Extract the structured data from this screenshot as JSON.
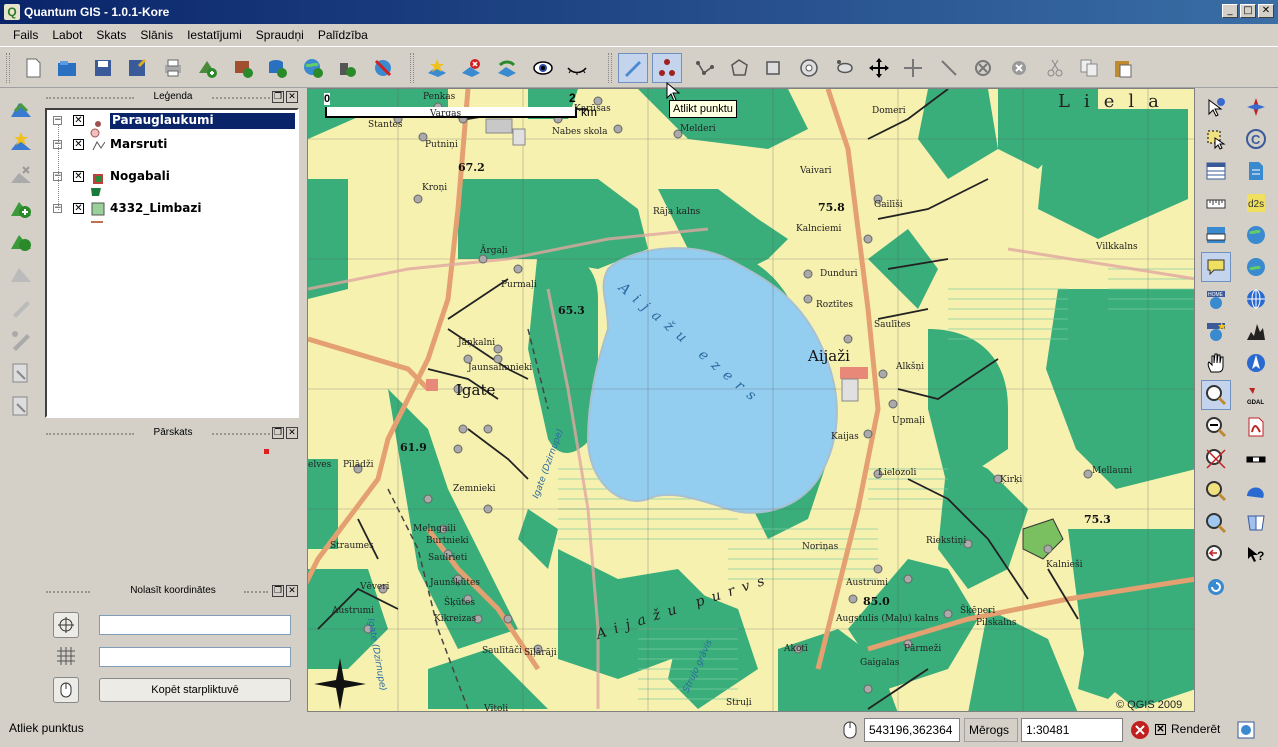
{
  "window": {
    "title": "Quantum GIS - 1.0.1-Kore",
    "app_icon_letter": "Q"
  },
  "menu": [
    "Fails",
    "Labot",
    "Skats",
    "Slānis",
    "Iestatījumi",
    "Spraudņi",
    "Palīdzība"
  ],
  "docks": {
    "legend": {
      "title": "Leģenda"
    },
    "overview": {
      "title": "Pārskats"
    },
    "coords": {
      "title": "Nolasīt koordinātes",
      "copy_button": "Kopēt starpliktuvē"
    }
  },
  "layers": [
    {
      "name": "Parauglaukumi",
      "checked": true,
      "selected": true
    },
    {
      "name": "Marsruti",
      "checked": true,
      "selected": false
    },
    {
      "name": "Nogabali",
      "checked": true,
      "selected": false
    },
    {
      "name": "4332_Limbazi",
      "checked": true,
      "selected": false
    }
  ],
  "map": {
    "tooltip": "Atlikt punktu",
    "scale_bar": {
      "start": "0",
      "end": "2",
      "unit": "km"
    },
    "copyright": "© QGIS 2009",
    "lake_name": "Aijažu ezers",
    "bog_name": "Aijažu purvs",
    "region_name": "Liela",
    "places": [
      "Penkas",
      "Vargas",
      "Karūsas",
      "Stantes",
      "Nabes skola",
      "Melderi",
      "Putniņi",
      "Kroņi",
      "Rāja kalns",
      "Ārgaļi",
      "Purmaļi",
      "Jāņkalni",
      "Jaunsaimnieki",
      "Igate",
      "Pīlādži",
      "Zemnieki",
      "Meļngaiļi",
      "Burtnieki",
      "Saulrieti",
      "Jaunšķūtes",
      "Šķūtes",
      "Ķikreizas",
      "Straumes",
      "Vēveri",
      "Austrumi",
      "Saulītāči",
      "Sīļārāji",
      "Vītoli",
      "Vaivari",
      "Gailīši",
      "Kalnciemi",
      "Dunduri",
      "Roztītes",
      "Saulītes",
      "Aijaži",
      "Alkšņi",
      "Upmaļi",
      "Kaijas",
      "Lielozoli",
      "Domeri",
      "Vilkkalns",
      "Mellauni",
      "Ķirķi",
      "Riekstiņi",
      "Kalnieši",
      "Noriņas",
      "Austrumi",
      "Augstulis (Maļu) kalns",
      "Gaigalas",
      "Pārmeži",
      "Šķēperi",
      "Pilskalns",
      "Akotī",
      "Struļi",
      "Igate (Dzirnupe)"
    ],
    "elevations": [
      "67.2",
      "65.3",
      "61.9",
      "75.8",
      "85.0",
      "75.3"
    ]
  },
  "status": {
    "message": "Atliek punktus",
    "coordinates": "543196,362364",
    "scale_label": "Mērogs",
    "scale_value": "1:30481",
    "render_label": "Renderēt",
    "render_checked": true
  },
  "colors": {
    "title_start": "#0a246a",
    "title_end": "#3a6ea5",
    "lake": "#93cdf0",
    "forest": "#3aae7a",
    "field": "#f7f1b0"
  }
}
